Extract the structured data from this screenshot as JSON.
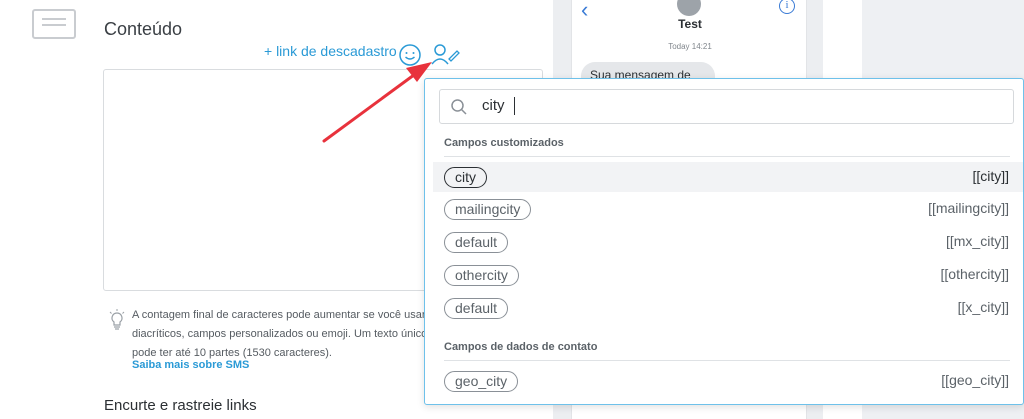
{
  "content": {
    "title": "Conteúdo",
    "unsubscribe_link": "+ link de descadastro",
    "hint_lines": [
      "A contagem final de caracteres pode aumentar se você usar",
      "diacríticos, campos personalizados ou emoji. Um texto único",
      "pode ter até 10 partes (1530 caracteres)."
    ],
    "learn_more": "Saiba mais sobre SMS",
    "next_section": "Encurte e rastreie links"
  },
  "preview": {
    "contact_name": "Test",
    "time": "Today 14:21",
    "message": "Sua mensagem de",
    "info_label": "i"
  },
  "picker": {
    "search": {
      "value": "city"
    },
    "custom_group": {
      "label": "Campos customizados",
      "items": [
        {
          "name": "city",
          "merge": "[[city]]",
          "highlighted": true
        },
        {
          "name": "mailingcity",
          "merge": "[[mailingcity]]"
        },
        {
          "name": "default",
          "merge": "[[mx_city]]"
        },
        {
          "name": "othercity",
          "merge": "[[othercity]]"
        },
        {
          "name": "default",
          "merge": "[[x_city]]"
        }
      ]
    },
    "contact_group": {
      "label": "Campos de dados de contato",
      "items": [
        {
          "name": "geo_city",
          "merge": "[[geo_city]]"
        }
      ]
    }
  },
  "colors": {
    "accent": "#2a9ad6",
    "annotation_arrow": "#e8323c",
    "dropdown_border": "#6ec1ea"
  },
  "icons": [
    "template-icon",
    "smile-icon",
    "person-edit-icon",
    "lightbulb-icon",
    "search-icon",
    "back-chevron-icon",
    "info-icon",
    "avatar-icon"
  ]
}
